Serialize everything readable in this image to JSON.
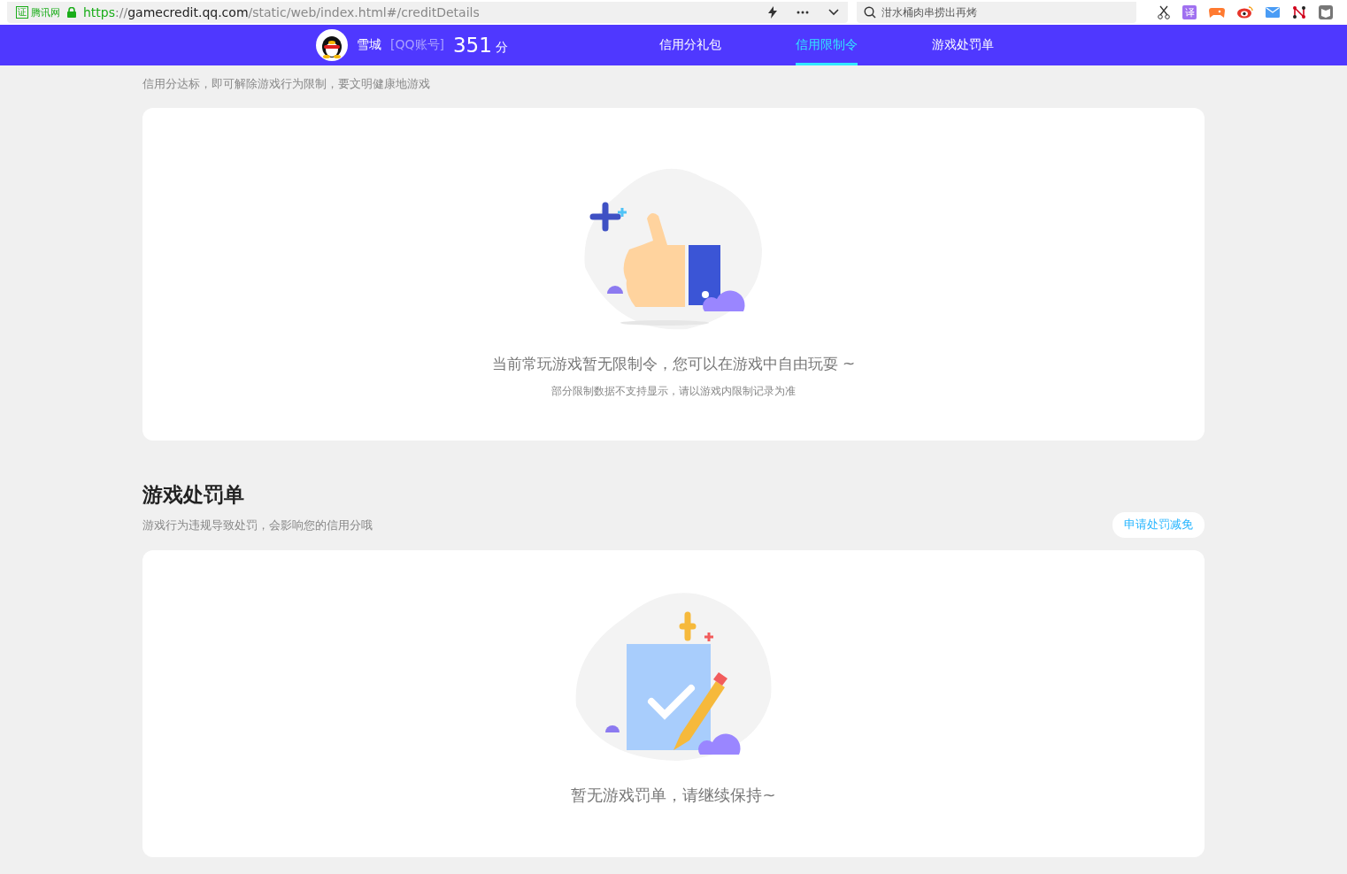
{
  "browser": {
    "site_badge": "证",
    "site_name": "腾讯网",
    "url": {
      "scheme": "https",
      "sep": "://",
      "host": "gamecredit.qq.com",
      "path": "/static/web/index.html#/creditDetails"
    },
    "search": {
      "value": "泔水桶肉串捞出再烤"
    },
    "translate_label": "译"
  },
  "nav": {
    "user_name": "雪城",
    "account_type": "[QQ账号]",
    "score": "351",
    "score_unit": "分",
    "tabs": [
      {
        "label": "信用分礼包",
        "selected": false
      },
      {
        "label": "信用限制令",
        "selected": true
      },
      {
        "label": "游戏处罚单",
        "selected": false
      }
    ]
  },
  "restriction": {
    "subtitle": "信用分达标，即可解除游戏行为限制，要文明健康地游戏",
    "empty_message": "当前常玩游戏暂无限制令，您可以在游戏中自由玩耍 ~",
    "note": "部分限制数据不支持显示，请以游戏内限制记录为准"
  },
  "penalty": {
    "title": "游戏处罚单",
    "subtitle": "游戏行为违规导致处罚，会影响您的信用分哦",
    "action": "申请处罚减免",
    "empty_message": "暂无游戏罚单，请继续保持~"
  }
}
